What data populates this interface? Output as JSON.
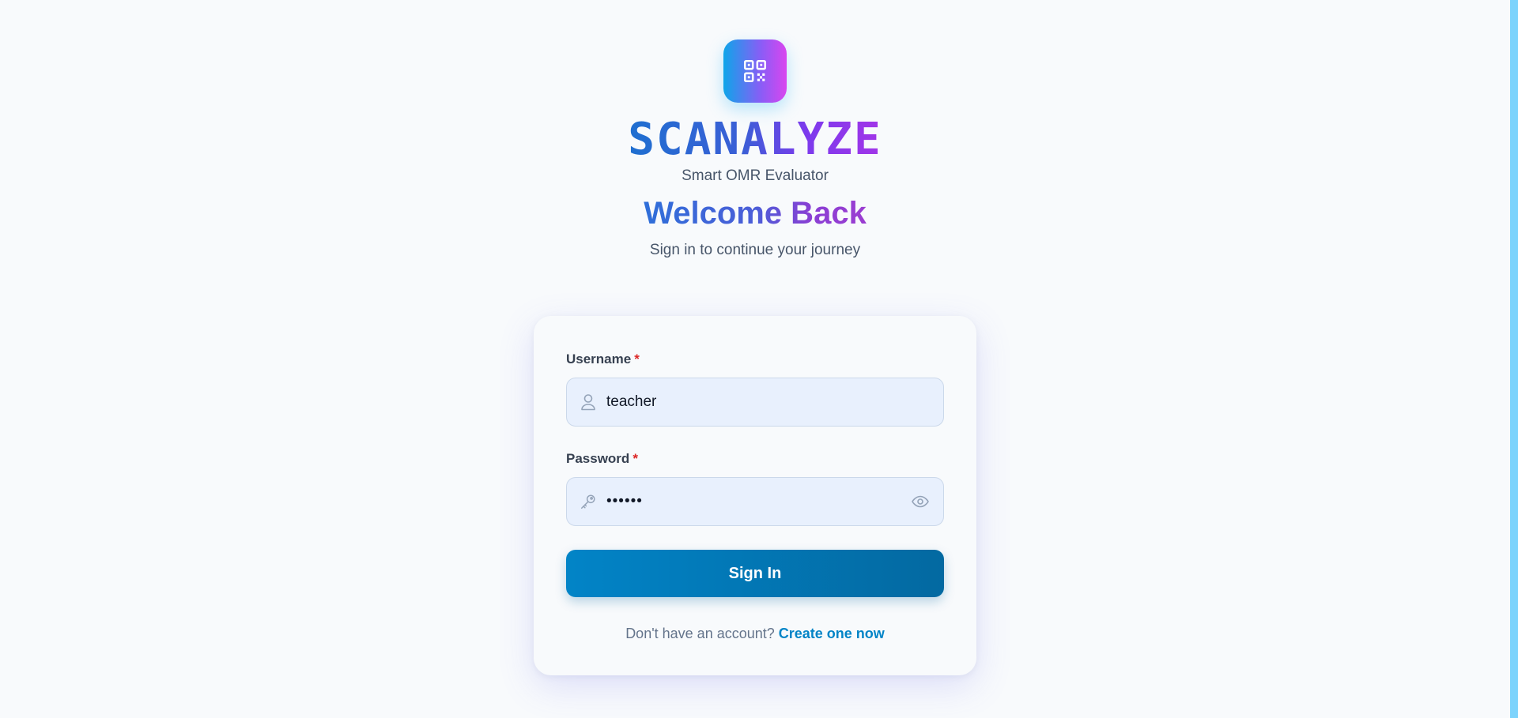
{
  "brand": {
    "logo_icon": "qr-code-icon",
    "name": "SCANALYZE",
    "tagline": "Smart OMR Evaluator"
  },
  "intro": {
    "heading": "Welcome Back",
    "subheading": "Sign in to continue your journey"
  },
  "form": {
    "username": {
      "label": "Username",
      "required_mark": "*",
      "value": "teacher",
      "icon": "user-icon"
    },
    "password": {
      "label": "Password",
      "required_mark": "*",
      "value": "••••••",
      "icon": "key-icon",
      "toggle_icon": "eye-icon"
    },
    "submit_label": "Sign In"
  },
  "footer": {
    "prompt": "Don't have an account?",
    "link_label": "Create one now"
  },
  "colors": {
    "accent": "#0284c7",
    "brand_gradient_start": "#0ea5e9",
    "brand_gradient_end": "#d946ef",
    "required": "#dc2626",
    "input_bg": "#e8f0fd"
  }
}
